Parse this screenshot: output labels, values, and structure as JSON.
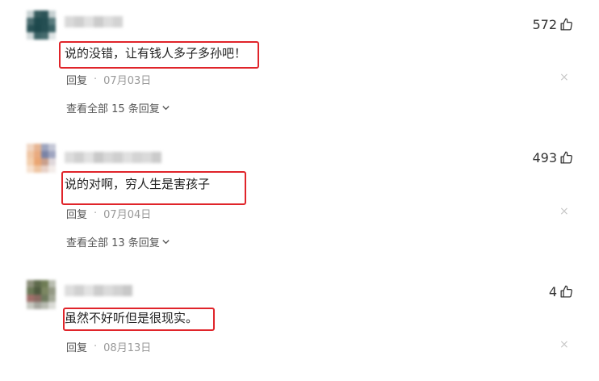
{
  "comments": [
    {
      "text": "说的没错，让有钱人多子多孙吧！",
      "likes": "572",
      "reply_label": "回复",
      "separator": "·",
      "date": "07月03日",
      "more_replies": "查看全部 15 条回复"
    },
    {
      "text": "说的对啊，穷人生是害孩子",
      "likes": "493",
      "reply_label": "回复",
      "separator": "·",
      "date": "07月04日",
      "more_replies": "查看全部 13 条回复"
    },
    {
      "text": "虽然不好听但是很现实。",
      "likes": "4",
      "reply_label": "回复",
      "separator": "·",
      "date": "08月13日"
    }
  ],
  "icons": {
    "like": "thumbs-up-icon",
    "close": "close-icon",
    "expand": "chevron-down-icon"
  },
  "colors": {
    "highlight_box": "#e0242a",
    "meta_text": "#999999"
  },
  "close_glyph": "×"
}
